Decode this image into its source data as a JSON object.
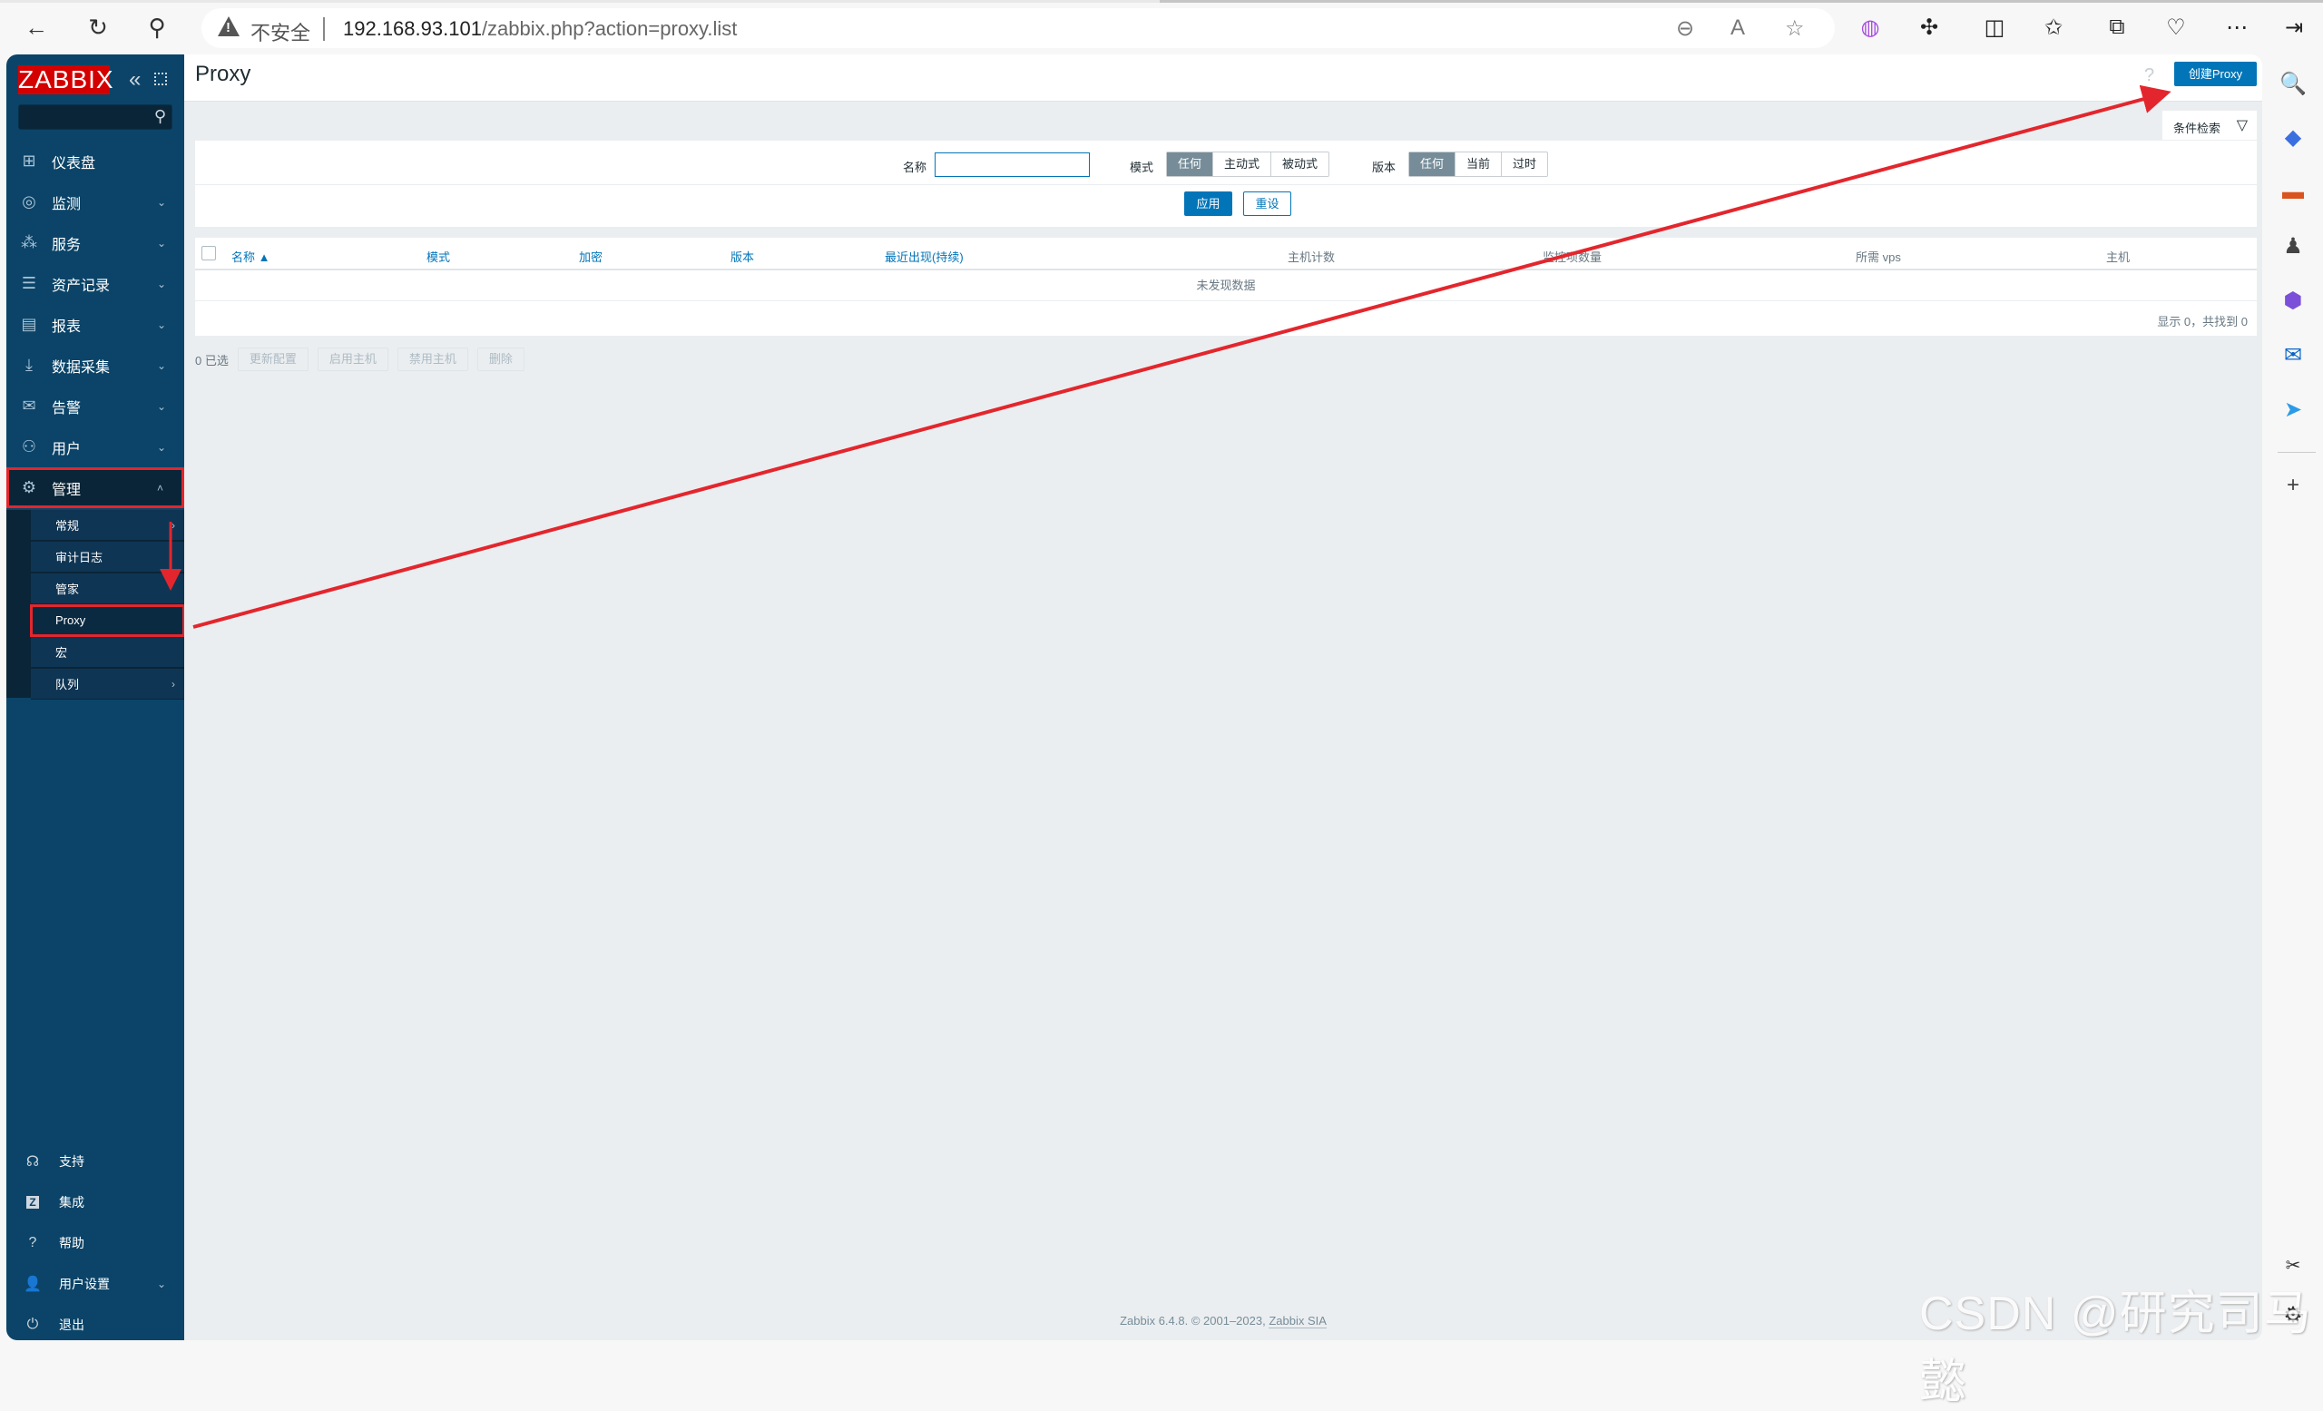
{
  "browser": {
    "insecure_label": "不安全",
    "url_host": "192.168.93.101",
    "url_path": "/zabbix.php?action=proxy.list"
  },
  "sidebar": {
    "logo": "ZABBIX",
    "search_placeholder": "",
    "items": [
      {
        "label": "仪表盘",
        "icon": "dashboard-icon"
      },
      {
        "label": "监测",
        "icon": "eye-icon",
        "chevron": "⌄"
      },
      {
        "label": "服务",
        "icon": "services-icon",
        "chevron": "⌄"
      },
      {
        "label": "资产记录",
        "icon": "list-icon",
        "chevron": "⌄"
      },
      {
        "label": "报表",
        "icon": "report-icon",
        "chevron": "⌄"
      },
      {
        "label": "数据采集",
        "icon": "download-icon",
        "chevron": "⌄"
      },
      {
        "label": "告警",
        "icon": "mail-icon",
        "chevron": "⌄"
      },
      {
        "label": "用户",
        "icon": "users-icon",
        "chevron": "⌄"
      },
      {
        "label": "管理",
        "icon": "gear-icon",
        "chevron": "˄"
      }
    ],
    "submenu": [
      {
        "label": "常规",
        "chevron": "›"
      },
      {
        "label": "审计日志"
      },
      {
        "label": "管家"
      },
      {
        "label": "Proxy"
      },
      {
        "label": "宏"
      },
      {
        "label": "队列",
        "chevron": "›"
      }
    ],
    "bottom": [
      {
        "label": "支持",
        "icon": "headset-icon"
      },
      {
        "label": "集成",
        "icon": "zabbix-integration-icon"
      },
      {
        "label": "帮助",
        "icon": "help-icon"
      },
      {
        "label": "用户设置",
        "icon": "user-icon",
        "chevron": "⌄"
      },
      {
        "label": "退出",
        "icon": "power-icon"
      }
    ]
  },
  "header": {
    "title": "Proxy",
    "help": "?",
    "create_button": "创建Proxy",
    "filter_tab": "条件检索"
  },
  "filter": {
    "name_label": "名称",
    "name_value": "",
    "mode_label": "模式",
    "mode_options": [
      "任何",
      "主动式",
      "被动式"
    ],
    "mode_selected": "任何",
    "version_label": "版本",
    "version_options": [
      "任何",
      "当前",
      "过时"
    ],
    "version_selected": "任何",
    "apply": "应用",
    "reset": "重设"
  },
  "table": {
    "columns": [
      "名称 ▲",
      "模式",
      "加密",
      "版本",
      "最近出现(持续)",
      "主机计数",
      "监控项数量",
      "所需 vps",
      "主机"
    ],
    "empty_message": "未发现数据",
    "paging": "显示 0，共找到 0"
  },
  "actions": {
    "selected": "0 已选",
    "buttons": [
      "更新配置",
      "启用主机",
      "禁用主机",
      "删除"
    ]
  },
  "footer": {
    "text": "Zabbix 6.4.8. © 2001–2023, ",
    "link": "Zabbix SIA"
  },
  "watermark": "CSDN @研究司马懿",
  "colors": {
    "sidebar": "#0b4468",
    "primary": "#0275b8",
    "logo": "#d40000",
    "annotation": "#e3262d"
  }
}
